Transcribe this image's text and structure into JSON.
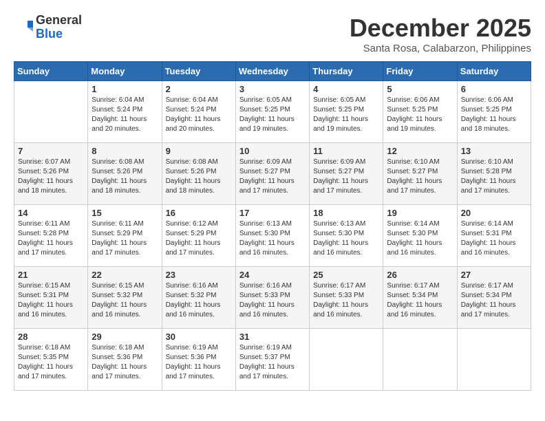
{
  "header": {
    "logo_general": "General",
    "logo_blue": "Blue",
    "month_title": "December 2025",
    "location": "Santa Rosa, Calabarzon, Philippines"
  },
  "days_of_week": [
    "Sunday",
    "Monday",
    "Tuesday",
    "Wednesday",
    "Thursday",
    "Friday",
    "Saturday"
  ],
  "weeks": [
    [
      {
        "day": "",
        "info": ""
      },
      {
        "day": "1",
        "info": "Sunrise: 6:04 AM\nSunset: 5:24 PM\nDaylight: 11 hours\nand 20 minutes."
      },
      {
        "day": "2",
        "info": "Sunrise: 6:04 AM\nSunset: 5:24 PM\nDaylight: 11 hours\nand 20 minutes."
      },
      {
        "day": "3",
        "info": "Sunrise: 6:05 AM\nSunset: 5:25 PM\nDaylight: 11 hours\nand 19 minutes."
      },
      {
        "day": "4",
        "info": "Sunrise: 6:05 AM\nSunset: 5:25 PM\nDaylight: 11 hours\nand 19 minutes."
      },
      {
        "day": "5",
        "info": "Sunrise: 6:06 AM\nSunset: 5:25 PM\nDaylight: 11 hours\nand 19 minutes."
      },
      {
        "day": "6",
        "info": "Sunrise: 6:06 AM\nSunset: 5:25 PM\nDaylight: 11 hours\nand 18 minutes."
      }
    ],
    [
      {
        "day": "7",
        "info": "Sunrise: 6:07 AM\nSunset: 5:26 PM\nDaylight: 11 hours\nand 18 minutes."
      },
      {
        "day": "8",
        "info": "Sunrise: 6:08 AM\nSunset: 5:26 PM\nDaylight: 11 hours\nand 18 minutes."
      },
      {
        "day": "9",
        "info": "Sunrise: 6:08 AM\nSunset: 5:26 PM\nDaylight: 11 hours\nand 18 minutes."
      },
      {
        "day": "10",
        "info": "Sunrise: 6:09 AM\nSunset: 5:27 PM\nDaylight: 11 hours\nand 17 minutes."
      },
      {
        "day": "11",
        "info": "Sunrise: 6:09 AM\nSunset: 5:27 PM\nDaylight: 11 hours\nand 17 minutes."
      },
      {
        "day": "12",
        "info": "Sunrise: 6:10 AM\nSunset: 5:27 PM\nDaylight: 11 hours\nand 17 minutes."
      },
      {
        "day": "13",
        "info": "Sunrise: 6:10 AM\nSunset: 5:28 PM\nDaylight: 11 hours\nand 17 minutes."
      }
    ],
    [
      {
        "day": "14",
        "info": "Sunrise: 6:11 AM\nSunset: 5:28 PM\nDaylight: 11 hours\nand 17 minutes."
      },
      {
        "day": "15",
        "info": "Sunrise: 6:11 AM\nSunset: 5:29 PM\nDaylight: 11 hours\nand 17 minutes."
      },
      {
        "day": "16",
        "info": "Sunrise: 6:12 AM\nSunset: 5:29 PM\nDaylight: 11 hours\nand 17 minutes."
      },
      {
        "day": "17",
        "info": "Sunrise: 6:13 AM\nSunset: 5:30 PM\nDaylight: 11 hours\nand 16 minutes."
      },
      {
        "day": "18",
        "info": "Sunrise: 6:13 AM\nSunset: 5:30 PM\nDaylight: 11 hours\nand 16 minutes."
      },
      {
        "day": "19",
        "info": "Sunrise: 6:14 AM\nSunset: 5:30 PM\nDaylight: 11 hours\nand 16 minutes."
      },
      {
        "day": "20",
        "info": "Sunrise: 6:14 AM\nSunset: 5:31 PM\nDaylight: 11 hours\nand 16 minutes."
      }
    ],
    [
      {
        "day": "21",
        "info": "Sunrise: 6:15 AM\nSunset: 5:31 PM\nDaylight: 11 hours\nand 16 minutes."
      },
      {
        "day": "22",
        "info": "Sunrise: 6:15 AM\nSunset: 5:32 PM\nDaylight: 11 hours\nand 16 minutes."
      },
      {
        "day": "23",
        "info": "Sunrise: 6:16 AM\nSunset: 5:32 PM\nDaylight: 11 hours\nand 16 minutes."
      },
      {
        "day": "24",
        "info": "Sunrise: 6:16 AM\nSunset: 5:33 PM\nDaylight: 11 hours\nand 16 minutes."
      },
      {
        "day": "25",
        "info": "Sunrise: 6:17 AM\nSunset: 5:33 PM\nDaylight: 11 hours\nand 16 minutes."
      },
      {
        "day": "26",
        "info": "Sunrise: 6:17 AM\nSunset: 5:34 PM\nDaylight: 11 hours\nand 16 minutes."
      },
      {
        "day": "27",
        "info": "Sunrise: 6:17 AM\nSunset: 5:34 PM\nDaylight: 11 hours\nand 17 minutes."
      }
    ],
    [
      {
        "day": "28",
        "info": "Sunrise: 6:18 AM\nSunset: 5:35 PM\nDaylight: 11 hours\nand 17 minutes."
      },
      {
        "day": "29",
        "info": "Sunrise: 6:18 AM\nSunset: 5:36 PM\nDaylight: 11 hours\nand 17 minutes."
      },
      {
        "day": "30",
        "info": "Sunrise: 6:19 AM\nSunset: 5:36 PM\nDaylight: 11 hours\nand 17 minutes."
      },
      {
        "day": "31",
        "info": "Sunrise: 6:19 AM\nSunset: 5:37 PM\nDaylight: 11 hours\nand 17 minutes."
      },
      {
        "day": "",
        "info": ""
      },
      {
        "day": "",
        "info": ""
      },
      {
        "day": "",
        "info": ""
      }
    ]
  ]
}
